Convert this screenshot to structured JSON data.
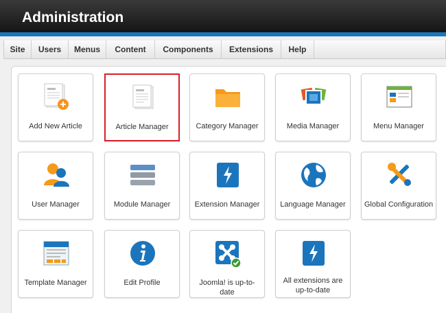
{
  "header": {
    "title": "Administration"
  },
  "menu": [
    {
      "label": "Site"
    },
    {
      "label": "Users"
    },
    {
      "label": "Menus"
    },
    {
      "label": "Content"
    },
    {
      "label": "Components"
    },
    {
      "label": "Extensions"
    },
    {
      "label": "Help"
    }
  ],
  "tiles": [
    {
      "label": "Add New Article",
      "icon": "add-article-icon"
    },
    {
      "label": "Article Manager",
      "icon": "article-icon",
      "selected": true
    },
    {
      "label": "Category Manager",
      "icon": "folder-icon"
    },
    {
      "label": "Media Manager",
      "icon": "media-icon"
    },
    {
      "label": "Menu Manager",
      "icon": "menu-icon"
    },
    {
      "label": "User Manager",
      "icon": "users-icon"
    },
    {
      "label": "Module Manager",
      "icon": "module-icon"
    },
    {
      "label": "Extension Manager",
      "icon": "extension-icon"
    },
    {
      "label": "Language Manager",
      "icon": "globe-icon"
    },
    {
      "label": "Global Configuration",
      "icon": "tools-icon"
    },
    {
      "label": "Template Manager",
      "icon": "template-icon"
    },
    {
      "label": "Edit Profile",
      "icon": "info-icon"
    },
    {
      "label": "Joomla! is up-to-date",
      "icon": "joomla-icon"
    },
    {
      "label": "All extensions are up-to-date",
      "icon": "extension-update-icon"
    }
  ],
  "colors": {
    "accent": "#1d76b8",
    "selected_border": "#d9202a"
  }
}
